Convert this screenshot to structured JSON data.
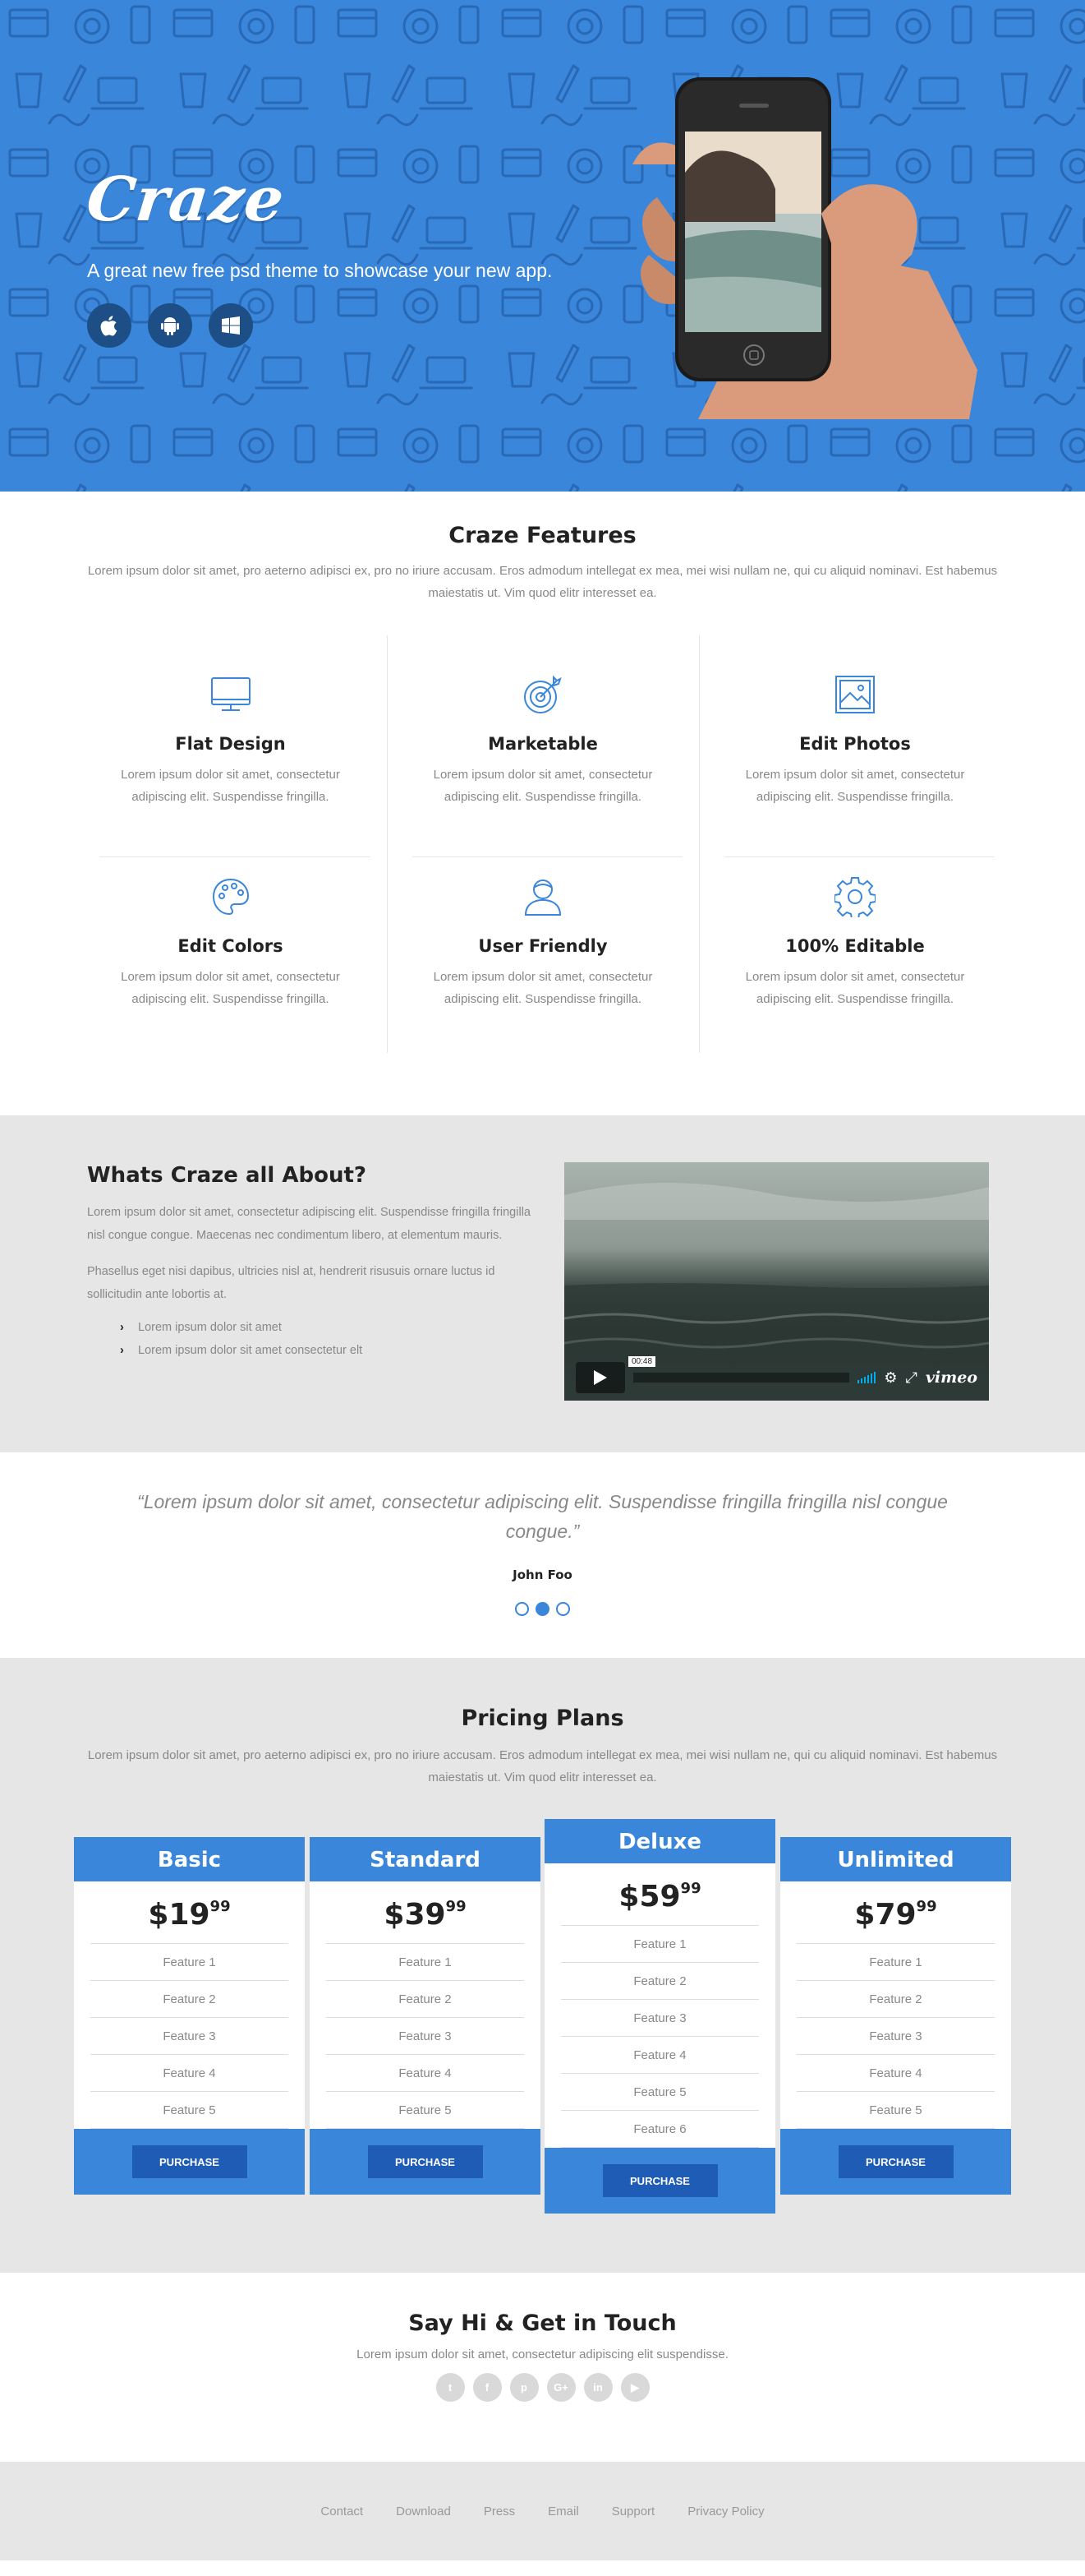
{
  "colors": {
    "brand_blue": "#3a86da",
    "dark_blue": "#1f5cb5",
    "grey_bg": "#e6e6e6",
    "text_grey": "#888888"
  },
  "hero": {
    "logo": "Craze",
    "tagline": "A great new free psd theme to showcase your new app.",
    "platforms": [
      {
        "icon": "apple-icon"
      },
      {
        "icon": "android-icon"
      },
      {
        "icon": "windows-icon"
      }
    ]
  },
  "features": {
    "title": "Craze Features",
    "subtitle": "Lorem ipsum dolor sit amet, pro aeterno adipisci ex, pro no iriure accusam. Eros admodum intellegat ex mea, mei wisi nullam ne, qui cu aliquid nominavi. Est habemus maiestatis ut. Vim quod elitr interesset ea.",
    "items": [
      {
        "icon": "monitor-icon",
        "title": "Flat Design",
        "text": "Lorem ipsum dolor sit amet, consectetur adipiscing elit. Suspendisse fringilla."
      },
      {
        "icon": "target-icon",
        "title": "Marketable",
        "text": "Lorem ipsum dolor sit amet, consectetur adipiscing elit. Suspendisse fringilla."
      },
      {
        "icon": "image-icon",
        "title": "Edit Photos",
        "text": "Lorem ipsum dolor sit amet, consectetur adipiscing elit. Suspendisse fringilla."
      },
      {
        "icon": "palette-icon",
        "title": "Edit Colors",
        "text": "Lorem ipsum dolor sit amet, consectetur adipiscing elit. Suspendisse fringilla."
      },
      {
        "icon": "user-icon",
        "title": "User Friendly",
        "text": "Lorem ipsum dolor sit amet, consectetur adipiscing elit. Suspendisse fringilla."
      },
      {
        "icon": "gear-icon",
        "title": "100% Editable",
        "text": "Lorem ipsum dolor sit amet, consectetur adipiscing elit. Suspendisse fringilla."
      }
    ]
  },
  "about": {
    "title": "Whats Craze all About?",
    "p1": "Lorem ipsum dolor sit amet, consectetur adipiscing elit. Suspendisse fringilla fringilla nisl congue congue. Maecenas nec condimentum libero, at elementum mauris.",
    "p2": "Phasellus eget nisi dapibus, ultricies nisl at, hendrerit risusuis ornare luctus id sollicitudin ante lobortis at.",
    "list": [
      "Lorem ipsum dolor sit amet",
      "Lorem ipsum dolor sit amet consectetur elt"
    ],
    "video": {
      "time": "00:48",
      "brand": "vimeo"
    }
  },
  "testimonial": {
    "quote": "“Lorem ipsum dolor sit amet, consectetur adipiscing elit. Suspendisse fringilla fringilla nisl congue congue.”",
    "author": "John Foo",
    "active_slide": 2,
    "slide_count": 3
  },
  "pricing": {
    "title": "Pricing Plans",
    "subtitle": "Lorem ipsum dolor sit amet, pro aeterno adipisci ex, pro no iriure accusam. Eros admodum intellegat ex mea, mei wisi nullam ne, qui cu aliquid nominavi. Est habemus maiestatis ut. Vim quod elitr interesset ea.",
    "plans": [
      {
        "name": "Basic",
        "price": "$19",
        "cents": "99",
        "features": [
          "Feature 1",
          "Feature 2",
          "Feature 3",
          "Feature 4",
          "Feature 5"
        ],
        "button": "PURCHASE"
      },
      {
        "name": "Standard",
        "price": "$39",
        "cents": "99",
        "features": [
          "Feature 1",
          "Feature 2",
          "Feature 3",
          "Feature 4",
          "Feature 5"
        ],
        "button": "PURCHASE"
      },
      {
        "name": "Deluxe",
        "price": "$59",
        "cents": "99",
        "features": [
          "Feature 1",
          "Feature 2",
          "Feature 3",
          "Feature 4",
          "Feature 5",
          "Feature 6"
        ],
        "button": "PURCHASE"
      },
      {
        "name": "Unlimited",
        "price": "$79",
        "cents": "99",
        "features": [
          "Feature 1",
          "Feature 2",
          "Feature 3",
          "Feature 4",
          "Feature 5"
        ],
        "button": "PURCHASE"
      }
    ]
  },
  "contact": {
    "title": "Say Hi & Get in Touch",
    "subtitle": "Lorem ipsum dolor sit amet, consectetur adipiscing elit suspendisse.",
    "socials": [
      {
        "icon": "twitter-icon",
        "glyph": "t"
      },
      {
        "icon": "facebook-icon",
        "glyph": "f"
      },
      {
        "icon": "pinterest-icon",
        "glyph": "p"
      },
      {
        "icon": "google-plus-icon",
        "glyph": "G+"
      },
      {
        "icon": "linkedin-icon",
        "glyph": "in"
      },
      {
        "icon": "youtube-icon",
        "glyph": "▶"
      }
    ]
  },
  "footer": {
    "links": [
      "Contact",
      "Download",
      "Press",
      "Email",
      "Support",
      "Privacy Policy"
    ]
  }
}
